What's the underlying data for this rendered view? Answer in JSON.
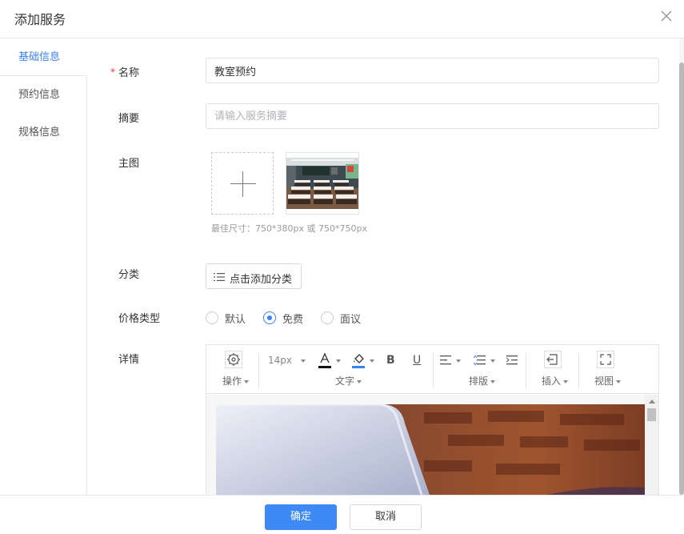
{
  "dialog": {
    "title": "添加服务"
  },
  "sidebar": {
    "tabs": [
      {
        "label": "基础信息",
        "active": true
      },
      {
        "label": "预约信息",
        "active": false
      },
      {
        "label": "规格信息",
        "active": false
      }
    ]
  },
  "form": {
    "name": {
      "required_mark": "*",
      "label": "名称",
      "value": "教室预约"
    },
    "summary": {
      "label": "摘要",
      "value": "",
      "placeholder": "请输入服务摘要"
    },
    "main_image": {
      "label": "主图",
      "hint": "最佳尺寸：750*380px 或 750*750px",
      "thumbnail_icon": "classroom-photo"
    },
    "category": {
      "label": "分类",
      "button_label": "点击添加分类",
      "icon": "list-icon"
    },
    "price_type": {
      "label": "价格类型",
      "options": [
        {
          "label": "默认",
          "checked": false
        },
        {
          "label": "免费",
          "checked": true
        },
        {
          "label": "面议",
          "checked": false
        }
      ]
    },
    "details": {
      "label": "详情",
      "toolbar": {
        "font_size": "14px",
        "bold": "B",
        "underline": "U",
        "groups": [
          "操作",
          "文字",
          "排版",
          "插入",
          "视图"
        ]
      }
    }
  },
  "footer": {
    "confirm_label": "确定",
    "cancel_label": "取消"
  },
  "colors": {
    "accent": "#3d8af7",
    "required": "#e53935"
  }
}
